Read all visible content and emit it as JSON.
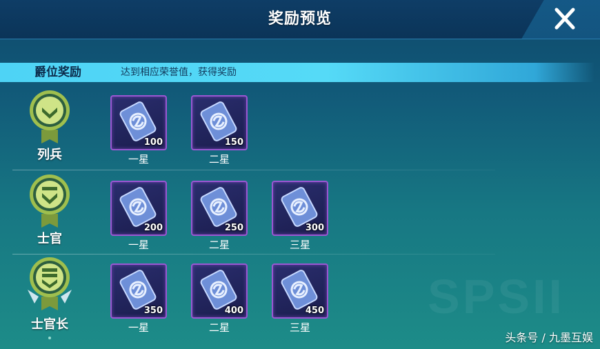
{
  "window": {
    "title": "奖励预览"
  },
  "section": {
    "title": "爵位奖励",
    "description": "达到相应荣誉值，获得奖励"
  },
  "ranks": [
    {
      "name": "列兵",
      "icon": "chevron-one-badge-icon",
      "rewards": [
        {
          "count": "100",
          "star": "一星"
        },
        {
          "count": "150",
          "star": "二星"
        }
      ]
    },
    {
      "name": "士官",
      "icon": "chevron-two-badge-icon",
      "rewards": [
        {
          "count": "200",
          "star": "一星"
        },
        {
          "count": "250",
          "star": "二星"
        },
        {
          "count": "300",
          "star": "三星"
        }
      ]
    },
    {
      "name": "士官长",
      "icon": "chevron-three-winged-badge-icon",
      "rewards": [
        {
          "count": "350",
          "star": "一星"
        },
        {
          "count": "400",
          "star": "二星"
        },
        {
          "count": "450",
          "star": "三星"
        }
      ]
    }
  ],
  "reward_icon": "s-coin-card-icon",
  "watermark": "头条号 / 九墨互娱",
  "colors": {
    "band": "#4ed3f5",
    "card_border": "#9a57d2",
    "badge": "#a9c45a"
  }
}
